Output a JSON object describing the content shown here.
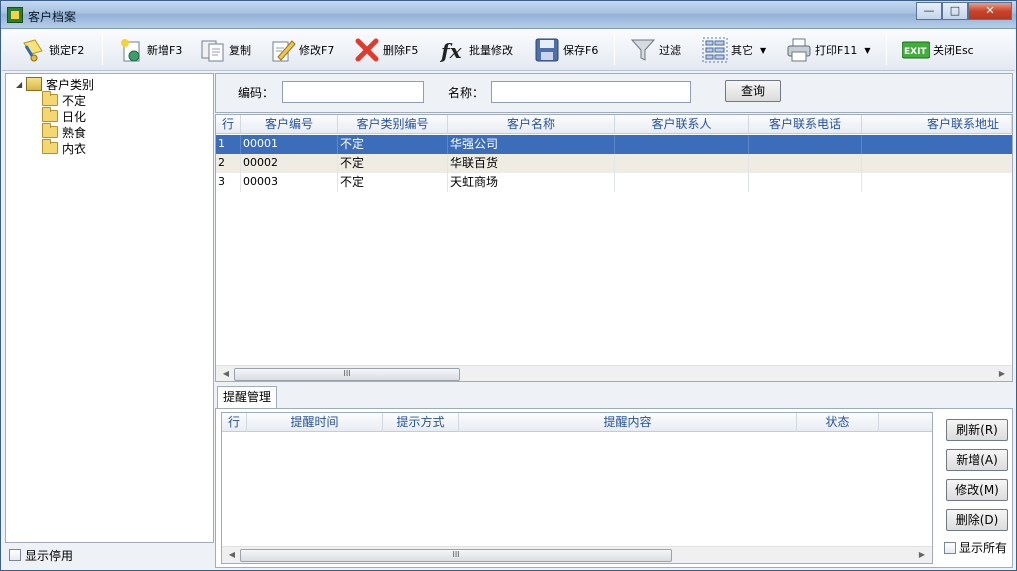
{
  "window": {
    "title": "客户档案",
    "controls": [
      "—",
      "□",
      "✕"
    ]
  },
  "toolbar": {
    "lock": "锁定F2",
    "add": "新增F3",
    "copy": "复制",
    "edit": "修改F7",
    "delete": "删除F5",
    "batch_edit": "批量修改",
    "save": "保存F6",
    "filter": "过滤",
    "other": "其它",
    "print": "打印F11",
    "close": "关闭Esc",
    "exit_icon_text": "EXIT"
  },
  "tree": {
    "root": "客户类别",
    "items": [
      "不定",
      "日化",
      "熟食",
      "内衣"
    ]
  },
  "show_disabled": "显示停用",
  "search": {
    "code_label": "编码：",
    "code_value": "",
    "name_label": "名称：",
    "name_value": "",
    "query_button": "查询"
  },
  "grid": {
    "columns": [
      "行",
      "客户编号",
      "客户类别编号",
      "客户名称",
      "客户联系人",
      "客户联系电话",
      "客户联系地址"
    ],
    "rows": [
      {
        "row": "1",
        "code": "00001",
        "category": "不定",
        "name": "华强公司",
        "contact": "",
        "phone": "",
        "address": ""
      },
      {
        "row": "2",
        "code": "00002",
        "category": "不定",
        "name": "华联百货",
        "contact": "",
        "phone": "",
        "address": ""
      },
      {
        "row": "3",
        "code": "00003",
        "category": "不定",
        "name": "天虹商场",
        "contact": "",
        "phone": "",
        "address": ""
      }
    ],
    "scroll_grip": "III"
  },
  "reminder": {
    "tab_label": "提醒管理",
    "columns": [
      "行",
      "提醒时间",
      "提示方式",
      "提醒内容",
      "状态"
    ],
    "buttons": {
      "refresh": "刷新(R)",
      "add": "新增(A)",
      "edit": "修改(M)",
      "delete": "删除(D)"
    },
    "show_all": "显示所有",
    "scroll_grip": "III"
  }
}
